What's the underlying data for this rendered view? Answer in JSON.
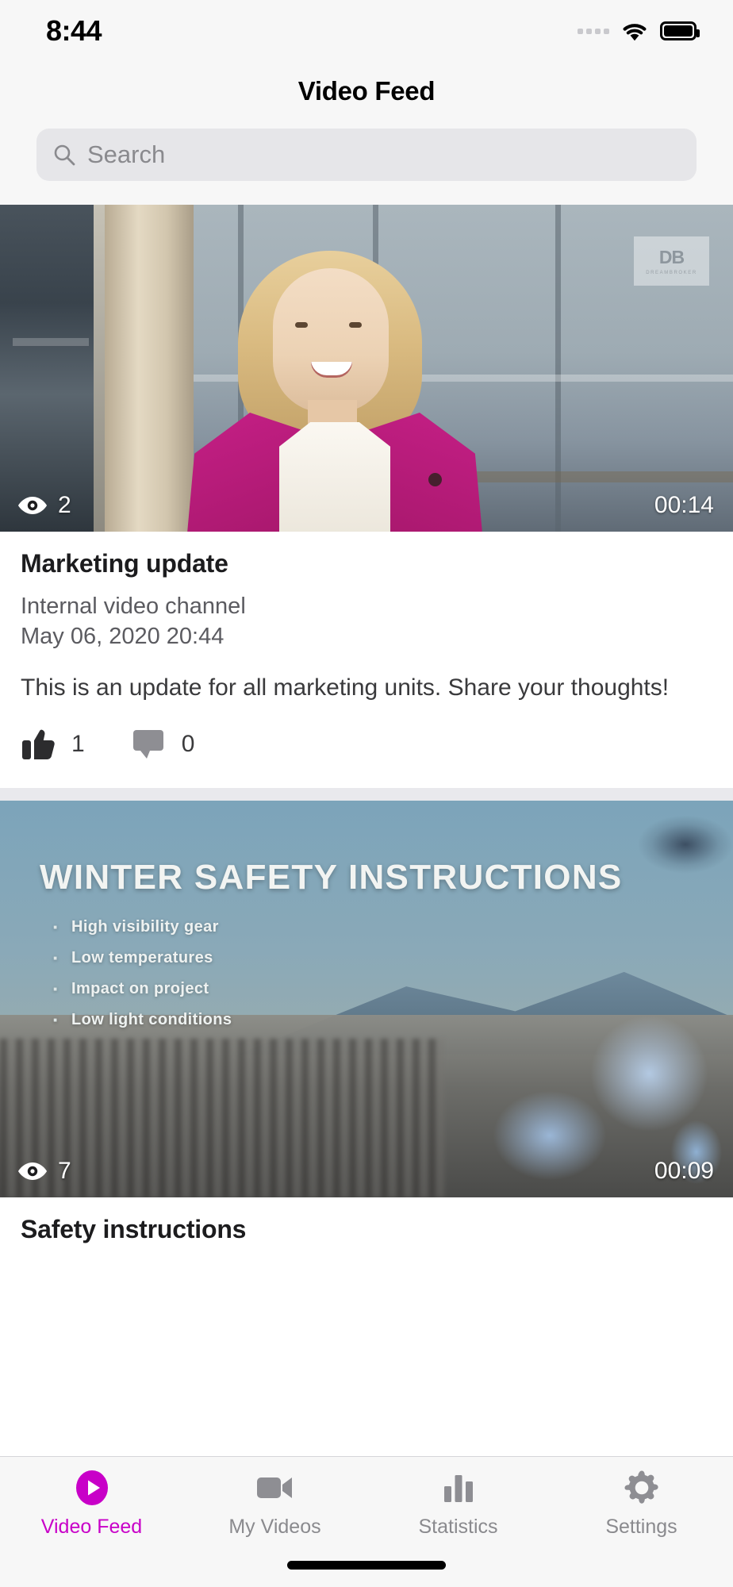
{
  "status_bar": {
    "time": "8:44",
    "signal_icon": "signal-dots-icon",
    "wifi_icon": "wifi-icon",
    "battery_icon": "battery-icon"
  },
  "header": {
    "title": "Video Feed"
  },
  "search": {
    "placeholder": "Search",
    "value": "",
    "icon": "search-icon"
  },
  "feed": {
    "items": [
      {
        "title": "Marketing update",
        "channel": "Internal video channel",
        "date": "May 06, 2020 20:44",
        "description": "This is an update for all marketing units. Share your thoughts!",
        "views": "2",
        "duration": "00:14",
        "likes": "1",
        "comments": "0",
        "views_icon": "eye-icon",
        "like_icon": "thumbs-up-icon",
        "comment_icon": "comment-bubble-icon",
        "thumbnail_watermark": "DB",
        "thumbnail_watermark_sub": "DREAMBROKER"
      },
      {
        "title": "Safety instructions",
        "views": "7",
        "duration": "00:09",
        "views_icon": "eye-icon",
        "slide_title": "WINTER SAFETY INSTRUCTIONS",
        "slide_bullets": [
          "High visibility gear",
          "Low temperatures",
          "Impact on project",
          "Low light conditions"
        ]
      }
    ]
  },
  "tabbar": {
    "items": [
      {
        "label": "Video Feed",
        "icon": "play-circle-icon",
        "active": true
      },
      {
        "label": "My Videos",
        "icon": "video-camera-icon",
        "active": false
      },
      {
        "label": "Statistics",
        "icon": "bar-chart-icon",
        "active": false
      },
      {
        "label": "Settings",
        "icon": "gear-icon",
        "active": false
      }
    ]
  },
  "colors": {
    "accent": "#c800c8",
    "background": "#ffffff",
    "chrome": "#f7f7f7",
    "search_field": "#e6e6e9",
    "muted_text": "#8a8a8e"
  }
}
